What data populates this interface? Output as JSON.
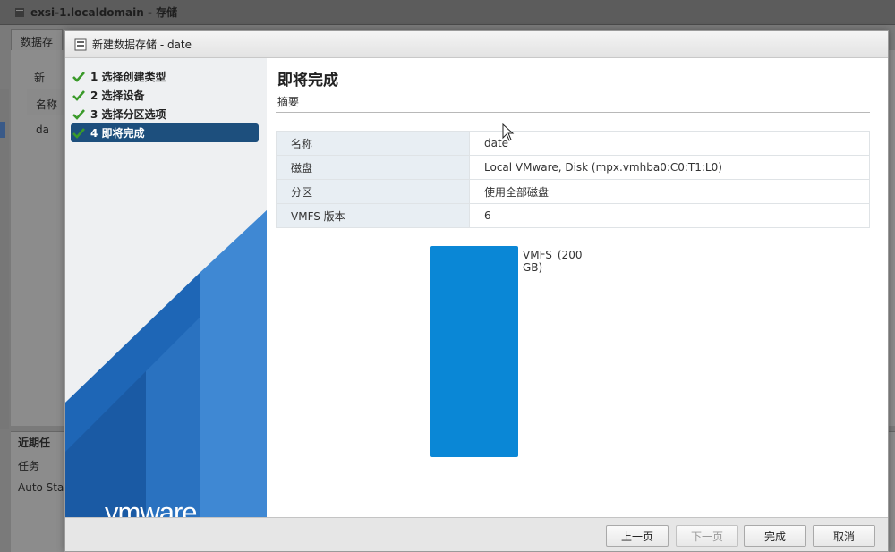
{
  "background": {
    "window_title": "exsi-1.localdomain - 存储",
    "tab_label": "数据存",
    "toolbar_item": "新",
    "column_header": "名称",
    "row_value": "da",
    "recent_tasks_title": "近期任",
    "recent_col_task": "任务",
    "recent_row_value": "Auto Star"
  },
  "dialog": {
    "title": "新建数据存储 - date",
    "steps": [
      {
        "label": "1 选择创建类型",
        "completed": true,
        "active": false
      },
      {
        "label": "2 选择设备",
        "completed": true,
        "active": false
      },
      {
        "label": "3 选择分区选项",
        "completed": true,
        "active": false
      },
      {
        "label": "4 即将完成",
        "completed": true,
        "active": true
      }
    ],
    "logo_text": "vmware",
    "page_title": "即将完成",
    "page_subtitle": "摘要",
    "summary": [
      {
        "key": "名称",
        "value": "date"
      },
      {
        "key": "磁盘",
        "value": "Local VMware, Disk (mpx.vmhba0:C0:T1:L0)"
      },
      {
        "key": "分区",
        "value": "使用全部磁盘"
      },
      {
        "key": "VMFS 版本",
        "value": "6"
      }
    ],
    "partition": {
      "name": "VMFS",
      "size": "(200 GB)",
      "fraction": 1.0,
      "color": "#0a87d6"
    },
    "buttons": {
      "prev": "上一页",
      "next": "下一页",
      "finish": "完成",
      "cancel": "取消"
    }
  },
  "colors": {
    "accent": "#1d4f7d",
    "check": "#3a9a2a",
    "vmfs": "#0a87d6"
  }
}
